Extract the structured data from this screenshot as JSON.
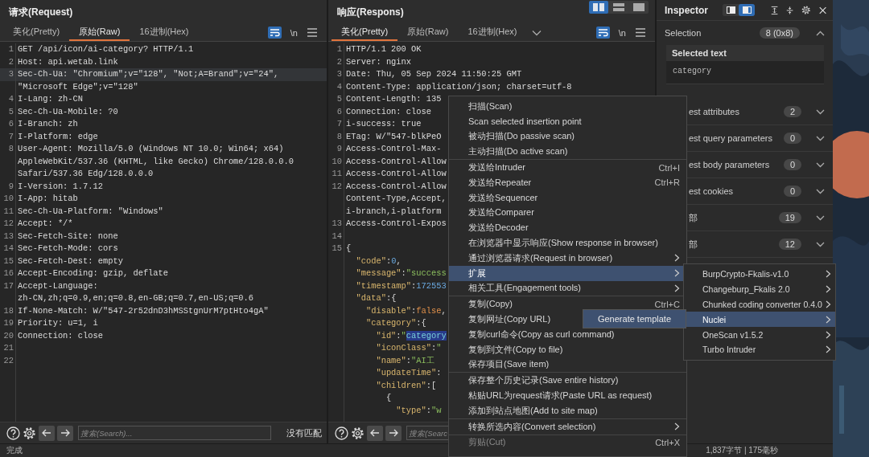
{
  "request": {
    "title": "请求(Request)",
    "tabs": [
      {
        "label": "美化(Pretty)",
        "selected": false
      },
      {
        "label": "原始(Raw)",
        "selected": true
      },
      {
        "label": "16进制(Hex)",
        "selected": false
      }
    ],
    "tab_menu": false,
    "wrap_lines": true,
    "newline_label": "\\n",
    "rows": [
      {
        "num": "1",
        "text": "GET /api/icon/ai-category? HTTP/1.1",
        "current": false
      },
      {
        "num": "2",
        "text": "Host: api.wetab.link",
        "current": false
      },
      {
        "num": "3",
        "text": "Sec-Ch-Ua: \"Chromium\";v=\"128\", \"Not;A=Brand\";v=\"24\",",
        "current": true
      },
      {
        "text": "\"Microsoft Edge\";v=\"128\"",
        "current": false
      },
      {
        "num": "4",
        "text": "I-Lang: zh-CN",
        "current": false
      },
      {
        "num": "5",
        "text": "Sec-Ch-Ua-Mobile: ?0",
        "current": false
      },
      {
        "num": "6",
        "text": "I-Branch: zh",
        "current": false
      },
      {
        "num": "7",
        "text": "I-Platform: edge",
        "current": false
      },
      {
        "num": "8",
        "text": "User-Agent: Mozilla/5.0 (Windows NT 10.0; Win64; x64)",
        "current": false
      },
      {
        "text": "AppleWebKit/537.36 (KHTML, like Gecko) Chrome/128.0.0.0",
        "current": false
      },
      {
        "text": "Safari/537.36 Edg/128.0.0.0",
        "current": false
      },
      {
        "num": "9",
        "text": "I-Version: 1.7.12",
        "current": false
      },
      {
        "num": "10",
        "text": "I-App: hitab",
        "current": false
      },
      {
        "num": "11",
        "text": "Sec-Ch-Ua-Platform: \"Windows\"",
        "current": false
      },
      {
        "num": "12",
        "text": "Accept: */*",
        "current": false
      },
      {
        "num": "13",
        "text": "Sec-Fetch-Site: none",
        "current": false
      },
      {
        "num": "14",
        "text": "Sec-Fetch-Mode: cors",
        "current": false
      },
      {
        "num": "15",
        "text": "Sec-Fetch-Dest: empty",
        "current": false
      },
      {
        "num": "16",
        "text": "Accept-Encoding: gzip, deflate",
        "current": false
      },
      {
        "num": "17",
        "text": "Accept-Language:",
        "current": false
      },
      {
        "text": "zh-CN,zh;q=0.9,en;q=0.8,en-GB;q=0.7,en-US;q=0.6",
        "current": false
      },
      {
        "num": "18",
        "text": "If-None-Match: W/\"547-2r52dnD3hMSStgnUrM7ptHto4gA\"",
        "current": false
      },
      {
        "num": "19",
        "text": "Priority: u=1, i",
        "current": false
      },
      {
        "num": "20",
        "text": "Connection: close",
        "current": false
      },
      {
        "num": "21",
        "current": false
      },
      {
        "num": "22",
        "current": false
      }
    ],
    "search": {
      "placeholder": "搜索(Search)..."
    },
    "match_status": "没有匹配"
  },
  "response": {
    "title": "响应(Respons)",
    "view_toggle": [
      {
        "kind": "columns",
        "selected": true
      },
      {
        "kind": "rows",
        "selected": false
      },
      {
        "kind": "single",
        "selected": false
      }
    ],
    "tabs": [
      {
        "label": "美化(Pretty)",
        "selected": true
      },
      {
        "label": "原始(Raw)",
        "selected": false
      },
      {
        "label": "16进制(Hex)",
        "selected": false
      }
    ],
    "tab_menu": true,
    "wrap_lines": true,
    "newline_label": "\\n",
    "rows": [
      {
        "num": "1",
        "text": "HTTP/1.1 200 OK",
        "current": false
      },
      {
        "num": "2",
        "text": "Server: nginx",
        "current": false
      },
      {
        "num": "3",
        "text": "Date: Thu, 05 Sep 2024 11:50:25 GMT",
        "current": false
      },
      {
        "num": "4",
        "text": "Content-Type: application/json; charset=utf-8",
        "current": false
      },
      {
        "num": "5",
        "text": "Content-Length: 135",
        "current": false
      },
      {
        "num": "6",
        "text": "Connection: close",
        "current": false
      },
      {
        "num": "7",
        "text": "i-success: true",
        "current": false
      },
      {
        "num": "8",
        "text": "ETag: W/\"547-blkPeO",
        "current": false
      },
      {
        "num": "9",
        "text": "Access-Control-Max-",
        "current": false
      },
      {
        "num": "10",
        "text": "Access-Control-Allow",
        "current": false
      },
      {
        "num": "11",
        "text": "Access-Control-Allow",
        "current": false
      },
      {
        "num": "12",
        "text": "Access-Control-Allow",
        "current": false
      },
      {
        "text": "Content-Type,Accept,",
        "current": false
      },
      {
        "text": "i-branch,i-platform",
        "current": false
      },
      {
        "num": "13",
        "text": "Access-Control-Expos",
        "current": false
      },
      {
        "num": "14",
        "current": false
      },
      {
        "num": "15",
        "text": "{",
        "current": false
      },
      {
        "segs": [
          {
            "kind": "key",
            "text": "  \"code\""
          },
          {
            "kind": "plain",
            "text": ":"
          },
          {
            "kind": "num",
            "text": "0"
          },
          {
            "kind": "plain",
            "text": ","
          }
        ],
        "current": false
      },
      {
        "segs": [
          {
            "kind": "key",
            "text": "  \"message\""
          },
          {
            "kind": "plain",
            "text": ":"
          },
          {
            "kind": "str",
            "text": "\"success"
          }
        ],
        "current": false
      },
      {
        "segs": [
          {
            "kind": "key",
            "text": "  \"timestamp\""
          },
          {
            "kind": "plain",
            "text": ":"
          },
          {
            "kind": "num",
            "text": "172553"
          }
        ],
        "current": false
      },
      {
        "segs": [
          {
            "kind": "key",
            "text": "  \"data\""
          },
          {
            "kind": "plain",
            "text": ":{"
          }
        ],
        "current": false
      },
      {
        "segs": [
          {
            "kind": "key",
            "text": "    \"disable\""
          },
          {
            "kind": "plain",
            "text": ":"
          },
          {
            "kind": "bool",
            "text": "false"
          },
          {
            "kind": "plain",
            "text": ","
          }
        ],
        "current": false
      },
      {
        "segs": [
          {
            "kind": "key",
            "text": "    \"category\""
          },
          {
            "kind": "plain",
            "text": ":{"
          }
        ],
        "current": false
      },
      {
        "segs": [
          {
            "kind": "key",
            "text": "      \"id\""
          },
          {
            "kind": "plain",
            "text": ":"
          },
          {
            "kind": "str",
            "text": "\""
          },
          {
            "kind": "sel",
            "text": "category"
          }
        ],
        "current": false
      },
      {
        "segs": [
          {
            "kind": "key",
            "text": "      \"iconClass\""
          },
          {
            "kind": "plain",
            "text": ":"
          },
          {
            "kind": "str",
            "text": "\""
          }
        ],
        "current": false
      },
      {
        "segs": [
          {
            "kind": "key",
            "text": "      \"name\""
          },
          {
            "kind": "plain",
            "text": ":"
          },
          {
            "kind": "str",
            "text": "\"AI工"
          }
        ],
        "current": false
      },
      {
        "segs": [
          {
            "kind": "key",
            "text": "      \"updateTime\""
          },
          {
            "kind": "plain",
            "text": ":"
          }
        ],
        "current": false
      },
      {
        "segs": [
          {
            "kind": "key",
            "text": "      \"children\""
          },
          {
            "kind": "plain",
            "text": ":["
          }
        ],
        "current": false
      },
      {
        "segs": [
          {
            "kind": "plain",
            "text": "        {"
          }
        ],
        "current": false
      },
      {
        "segs": [
          {
            "kind": "key",
            "text": "          \"type\""
          },
          {
            "kind": "plain",
            "text": ":"
          },
          {
            "kind": "str",
            "text": "\"w"
          }
        ],
        "current": false
      }
    ],
    "search": {
      "placeholder": "搜索(Searc"
    }
  },
  "inspector": {
    "title": "Inspector",
    "layout_buttons": [
      {
        "selected": false
      },
      {
        "selected": true
      }
    ],
    "selection": {
      "label": "Selection",
      "count": "8 (0x8)",
      "expanded": true,
      "heading": "Selected text",
      "value": "category"
    },
    "sections": [
      {
        "label": "est attributes",
        "count": "2",
        "expanded": false
      },
      {
        "label": "est query parameters",
        "count": "0",
        "expanded": false
      },
      {
        "label": "est body parameters",
        "count": "0",
        "expanded": false
      },
      {
        "label": "est cookies",
        "count": "0",
        "expanded": false
      },
      {
        "label": "部",
        "count": "19",
        "expanded": false
      },
      {
        "label": "部",
        "count": "12",
        "expanded": false
      }
    ]
  },
  "status_bar": {
    "left": "完成",
    "right": "1,837字节 | 175毫秒"
  },
  "context_menu": {
    "groups": [
      [
        {
          "label": "扫描(Scan)",
          "submenu": false,
          "selected": false,
          "disabled": false
        },
        {
          "label": "Scan selected insertion point",
          "submenu": false,
          "selected": false,
          "disabled": false
        },
        {
          "label": "被动扫描(Do passive scan)",
          "submenu": false,
          "selected": false,
          "disabled": false
        },
        {
          "label": "主动扫描(Do active scan)",
          "submenu": false,
          "selected": false,
          "disabled": false
        }
      ],
      [
        {
          "label": "发送给Intruder",
          "shortcut": "Ctrl+I",
          "submenu": false,
          "selected": false,
          "disabled": false
        },
        {
          "label": "发送给Repeater",
          "shortcut": "Ctrl+R",
          "submenu": false,
          "selected": false,
          "disabled": false
        },
        {
          "label": "发送给Sequencer",
          "submenu": false,
          "selected": false,
          "disabled": false
        },
        {
          "label": "发送给Comparer",
          "submenu": false,
          "selected": false,
          "disabled": false
        },
        {
          "label": "发送给Decoder",
          "submenu": false,
          "selected": false,
          "disabled": false
        },
        {
          "label": "在浏览器中显示响应(Show response in browser)",
          "submenu": false,
          "selected": false,
          "disabled": false
        },
        {
          "label": "通过浏览器请求(Request in browser)",
          "submenu": true,
          "selected": false,
          "disabled": false
        },
        {
          "label": "扩展",
          "submenu": true,
          "selected": true,
          "disabled": false
        },
        {
          "label": "相关工具(Engagement tools)",
          "submenu": true,
          "selected": false,
          "disabled": false
        }
      ],
      [
        {
          "label": "复制(Copy)",
          "shortcut": "Ctrl+C",
          "submenu": false,
          "selected": false,
          "disabled": false
        },
        {
          "label": "复制网址(Copy URL)",
          "selected": false,
          "disabled": false
        },
        {
          "label": "复制curl命令(Copy as curl command)",
          "submenu": false,
          "selected": false,
          "disabled": false
        },
        {
          "label": "复制到文件(Copy to file)",
          "submenu": false,
          "selected": false,
          "disabled": false
        },
        {
          "label": "保存项目(Save item)",
          "submenu": false,
          "selected": false,
          "disabled": false
        }
      ],
      [
        {
          "label": "保存整个历史记录(Save entire history)",
          "submenu": false,
          "selected": false,
          "disabled": false
        },
        {
          "label": "粘贴URL为request请求(Paste URL as request)",
          "submenu": false,
          "selected": false,
          "disabled": false
        },
        {
          "label": "添加到站点地图(Add to site map)",
          "submenu": false,
          "selected": false,
          "disabled": false
        }
      ],
      [
        {
          "label": "转换所选内容(Convert selection)",
          "submenu": true,
          "selected": false,
          "disabled": false
        }
      ],
      [
        {
          "label": "剪贴(Cut)",
          "shortcut": "Ctrl+X",
          "submenu": false,
          "selected": false,
          "disabled": true
        }
      ]
    ]
  },
  "extensions_menu": {
    "items": [
      {
        "label": "BurpCrypto-Fkalis-v1.0",
        "submenu": true,
        "selected": false
      },
      {
        "label": "Changeburp_Fkalis 2.0",
        "submenu": true,
        "selected": false
      },
      {
        "label": "Chunked coding converter 0.4.0",
        "submenu": true,
        "selected": false
      },
      {
        "label": "Nuclei",
        "submenu": true,
        "selected": true
      },
      {
        "label": "OneScan v1.5.2",
        "submenu": true,
        "selected": false
      },
      {
        "label": "Turbo Intruder",
        "submenu": true,
        "selected": false
      }
    ]
  },
  "nuclei_menu": {
    "items": [
      {
        "label": "Generate template",
        "selected": true
      }
    ]
  }
}
